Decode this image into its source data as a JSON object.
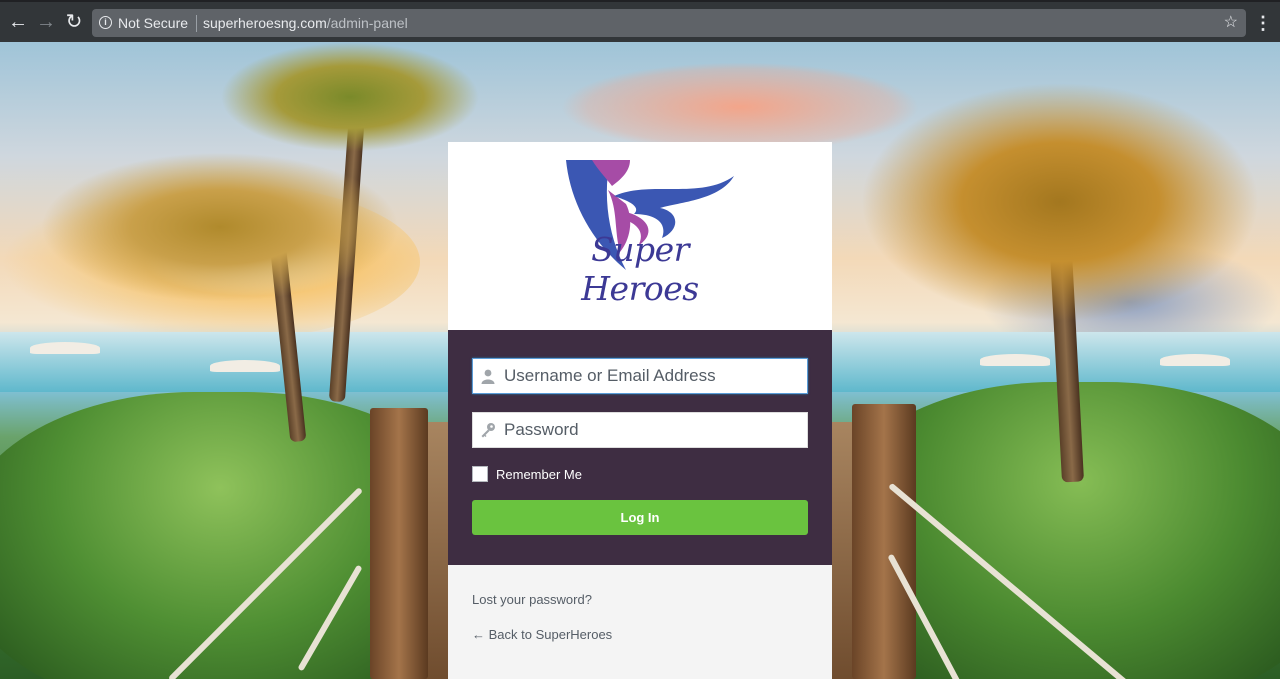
{
  "browser": {
    "security_label": "Not Secure",
    "url_domain": "superheroesng.com",
    "url_path": "/admin-panel"
  },
  "logo": {
    "text": "Super Heroes",
    "colors": {
      "purple": "#3c3995",
      "magenta": "#a64ca6",
      "blue": "#3b57b3"
    }
  },
  "login": {
    "username_placeholder": "Username or Email Address",
    "password_placeholder": "Password",
    "remember_label": "Remember Me",
    "remember_checked": false,
    "submit_label": "Log In"
  },
  "footer_links": {
    "lost_password": "Lost your password?",
    "back_to_site": "← Back to SuperHeroes"
  },
  "colors": {
    "form_bg": "#3e2d42",
    "button_green": "#6ac33f",
    "links_bg": "#f4f4f4"
  }
}
